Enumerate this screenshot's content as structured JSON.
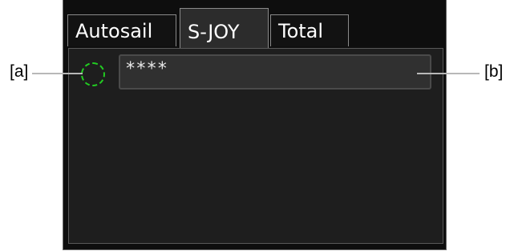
{
  "tabs": [
    {
      "label": "Autosail"
    },
    {
      "label": "S-JOY"
    },
    {
      "label": "Total"
    }
  ],
  "field": {
    "value": "****"
  },
  "callouts": {
    "a": "[a]",
    "b": "[b]"
  },
  "colors": {
    "indicator": "#22cc22",
    "active_tab": "#2c2c2c"
  }
}
